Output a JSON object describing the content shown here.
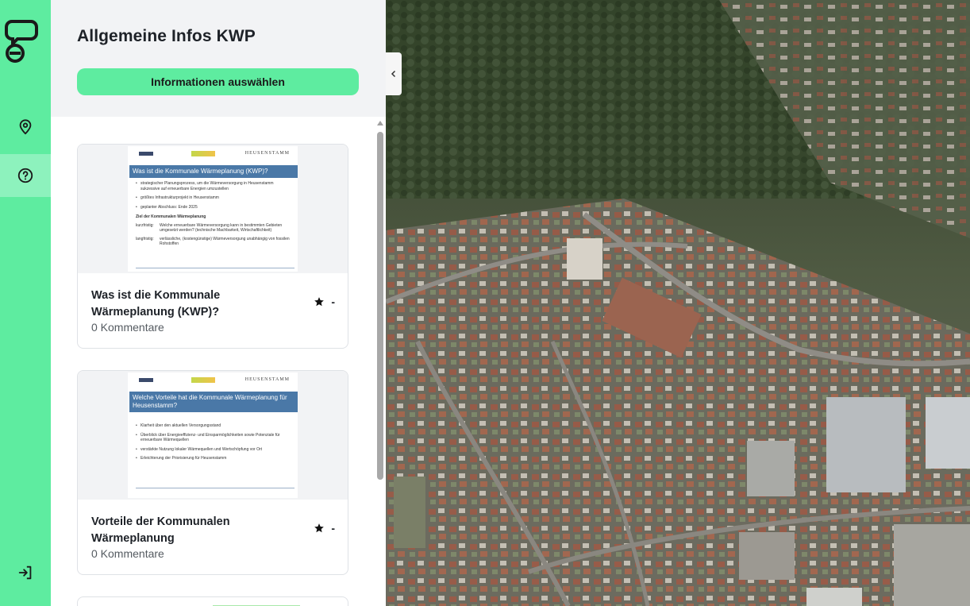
{
  "sidebar": {
    "logo_icon": "speech-bubble-logo-icon",
    "items": [
      {
        "name": "location-pin-icon",
        "active": false
      },
      {
        "name": "question-circle-icon",
        "active": true
      }
    ],
    "bottom": {
      "name": "login-icon"
    }
  },
  "panel": {
    "title": "Allgemeine Infos KWP",
    "select_button": "Informationen auswählen",
    "cards": [
      {
        "title": "Was ist die Kommunale Wärmeplanung (KWP)?",
        "comments": "0 Kommentare",
        "rating": "-",
        "slide": {
          "header": "Was ist die Kommunale Wärmeplanung (KWP)?",
          "brand": "HEUSENSTAMM",
          "bullets": [
            "strategischer Planungsprozess, um die Wärmeversorgung in Heusenstamm sukzessive auf erneuerbare Energien umzustellen",
            "größtes Infrastrukturprojekt in Heusenstamm",
            "geplanter Abschluss: Ende 2025"
          ],
          "subheading": "Ziel der Kommunalen Wärmeplanung",
          "rows": [
            {
              "k": "kurzfristig:",
              "v": "Welche erneuerbare Wärmeversorgung kann in bestimmten Gebieten umgesetzt werden? (technische Machbarkeit, Wirtschaftlichkeit)"
            },
            {
              "k": "langfristig:",
              "v": "verlässliche, (kostengünstige) Wärmeversorgung unabhängig von fossilen Rohstoffen"
            }
          ]
        }
      },
      {
        "title": "Vorteile der Kommunalen Wärmeplanung",
        "comments": "0 Kommentare",
        "rating": "-",
        "slide": {
          "header": "Welche Vorteile hat die Kommunale Wärmeplanung für Heusenstamm?",
          "brand": "HEUSENSTAMM",
          "bullets": [
            "Klarheit über den aktuellen Versorgungsstand",
            "Überblick über Energieeffizienz- und Einsparmöglichkeiten sowie Potenziale für erneuerbare Wärmequellen",
            "verstärkte Nutzung lokaler Wärmequellen und Wertschöpfung vor Ort",
            "Erleichterung der Priorisierung für Heusenstamm"
          ]
        }
      }
    ]
  },
  "map": {
    "icon": "chevron-left-icon"
  },
  "colors": {
    "accent": "#5eeca0",
    "accent_active": "#8df2bd",
    "slide_blue": "#4a78a7"
  }
}
